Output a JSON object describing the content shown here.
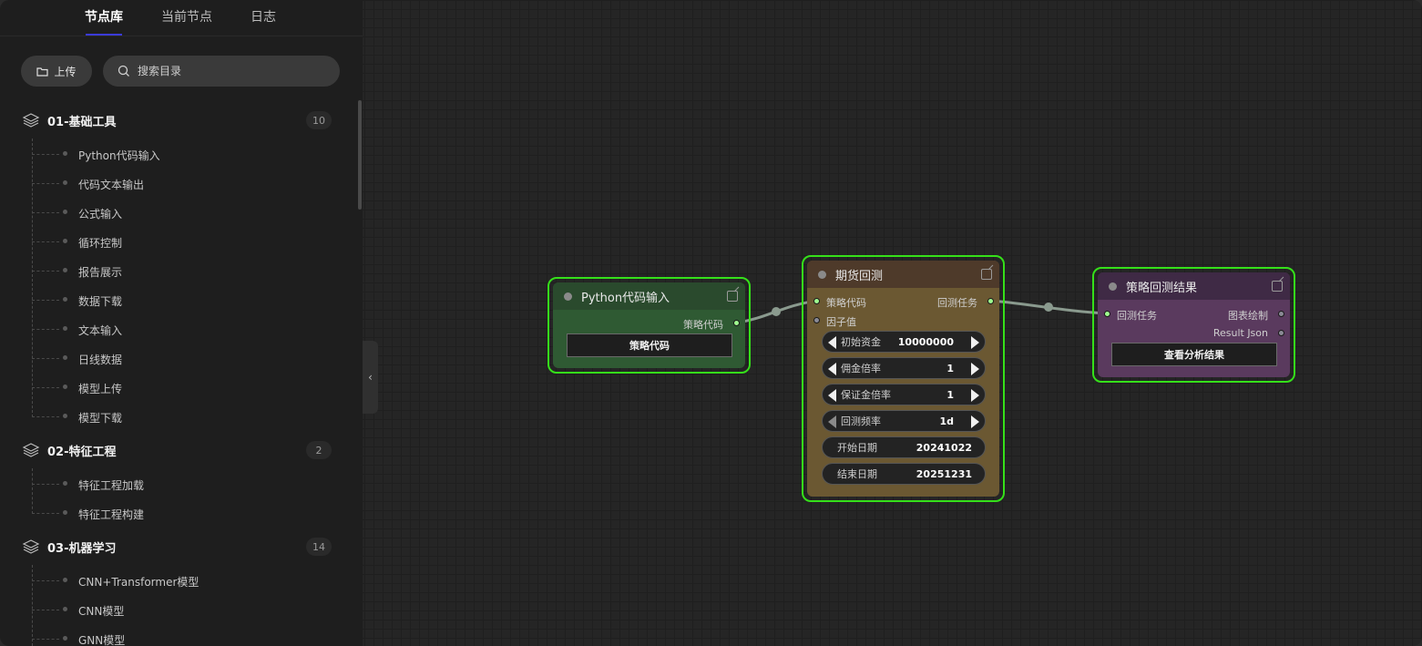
{
  "sidebar": {
    "tabs": [
      "节点库",
      "当前节点",
      "日志"
    ],
    "upload_label": "上传",
    "search_placeholder": "搜索目录",
    "categories": [
      {
        "label": "01-基础工具",
        "count": "10",
        "items": [
          "Python代码输入",
          "代码文本输出",
          "公式输入",
          "循环控制",
          "报告展示",
          "数据下载",
          "文本输入",
          "日线数据",
          "模型上传",
          "模型下载"
        ]
      },
      {
        "label": "02-特征工程",
        "count": "2",
        "items": [
          "特征工程加载",
          "特征工程构建"
        ]
      },
      {
        "label": "03-机器学习",
        "count": "14",
        "items": [
          "CNN+Transformer模型",
          "CNN模型",
          "GNN模型"
        ]
      }
    ]
  },
  "nodes": {
    "python_input": {
      "title": "Python代码输入",
      "output_label": "策略代码",
      "button_label": "策略代码",
      "bg": "#2f5a33",
      "header_bg": "#2a4a2d"
    },
    "futures_backtest": {
      "title": "期货回测",
      "inputs": [
        "策略代码",
        "因子值"
      ],
      "output_label": "回测任务",
      "widgets": [
        {
          "label": "初始资金",
          "value": "10000000",
          "arrows": true
        },
        {
          "label": "佣金倍率",
          "value": "1",
          "arrows": true
        },
        {
          "label": "保证金倍率",
          "value": "1",
          "arrows": true
        },
        {
          "label": "回测频率",
          "value": "1d",
          "arrows": true
        },
        {
          "label": "开始日期",
          "value": "20241022",
          "arrows": false
        },
        {
          "label": "结束日期",
          "value": "20251231",
          "arrows": false
        }
      ],
      "bg": "#6b5832",
      "header_bg": "#4e3a2a"
    },
    "result": {
      "title": "策略回测结果",
      "input_label": "回测任务",
      "outputs": [
        "图表绘制",
        "Result Json"
      ],
      "button_label": "查看分析结果",
      "bg": "#5a3a5e",
      "header_bg": "#3f2a45"
    }
  },
  "colors": {
    "node_border": "#35e01a",
    "active_tab_underline": "#3b3bd9",
    "link": "#8a9a8e"
  },
  "icons": {
    "upload": "folder-icon",
    "search": "search-icon",
    "category": "layers-icon",
    "collapse": "chevron-left-icon",
    "edit": "edit-icon"
  }
}
